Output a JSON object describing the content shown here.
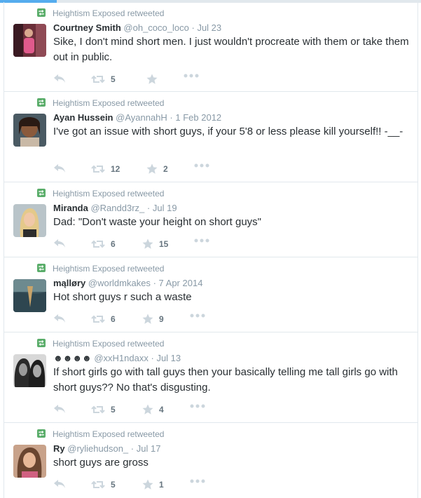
{
  "retweeter_line": "Heightism Exposed retweeted",
  "colors": {
    "retweet_green": "#5aad6a",
    "muted": "#8899a6",
    "accent": "#55acee"
  },
  "tweets": [
    {
      "name": "Courtney Smith",
      "handle": "@oh_coco_loco",
      "date": "Jul 23",
      "text": "Sike, I don't mind short men. I just wouldn't procreate with them or take them out in public.",
      "retweets": "5",
      "favorites": ""
    },
    {
      "name": "Ayan Hussein",
      "handle": "@AyannahH",
      "date": "1 Feb 2012",
      "text": "I've got an issue with short guys, if your 5'8 or less please kill yourself!! -__-",
      "retweets": "12",
      "favorites": "2"
    },
    {
      "name": "Miranda",
      "handle": "@Randd3rz_",
      "date": "Jul 19",
      "text": "Dad: \"Don't waste your height on short guys\"",
      "retweets": "6",
      "favorites": "15"
    },
    {
      "name": "mąlløry",
      "handle": "@worldmkakes",
      "date": "7 Apr 2014",
      "text": "Hot short guys r such a waste",
      "retweets": "6",
      "favorites": "9"
    },
    {
      "name": "☻☻☻☻",
      "handle": "@xxH1ndaxx",
      "date": "Jul 13",
      "text": "If short girls go with tall guys then your basically telling me tall girls go with short guys?? No that's disgusting.",
      "retweets": "5",
      "favorites": "4"
    },
    {
      "name": "Ry",
      "handle": "@ryliehudson_",
      "date": "Jul 17",
      "text": "short guys are gross",
      "retweets": "5",
      "favorites": "1"
    }
  ]
}
